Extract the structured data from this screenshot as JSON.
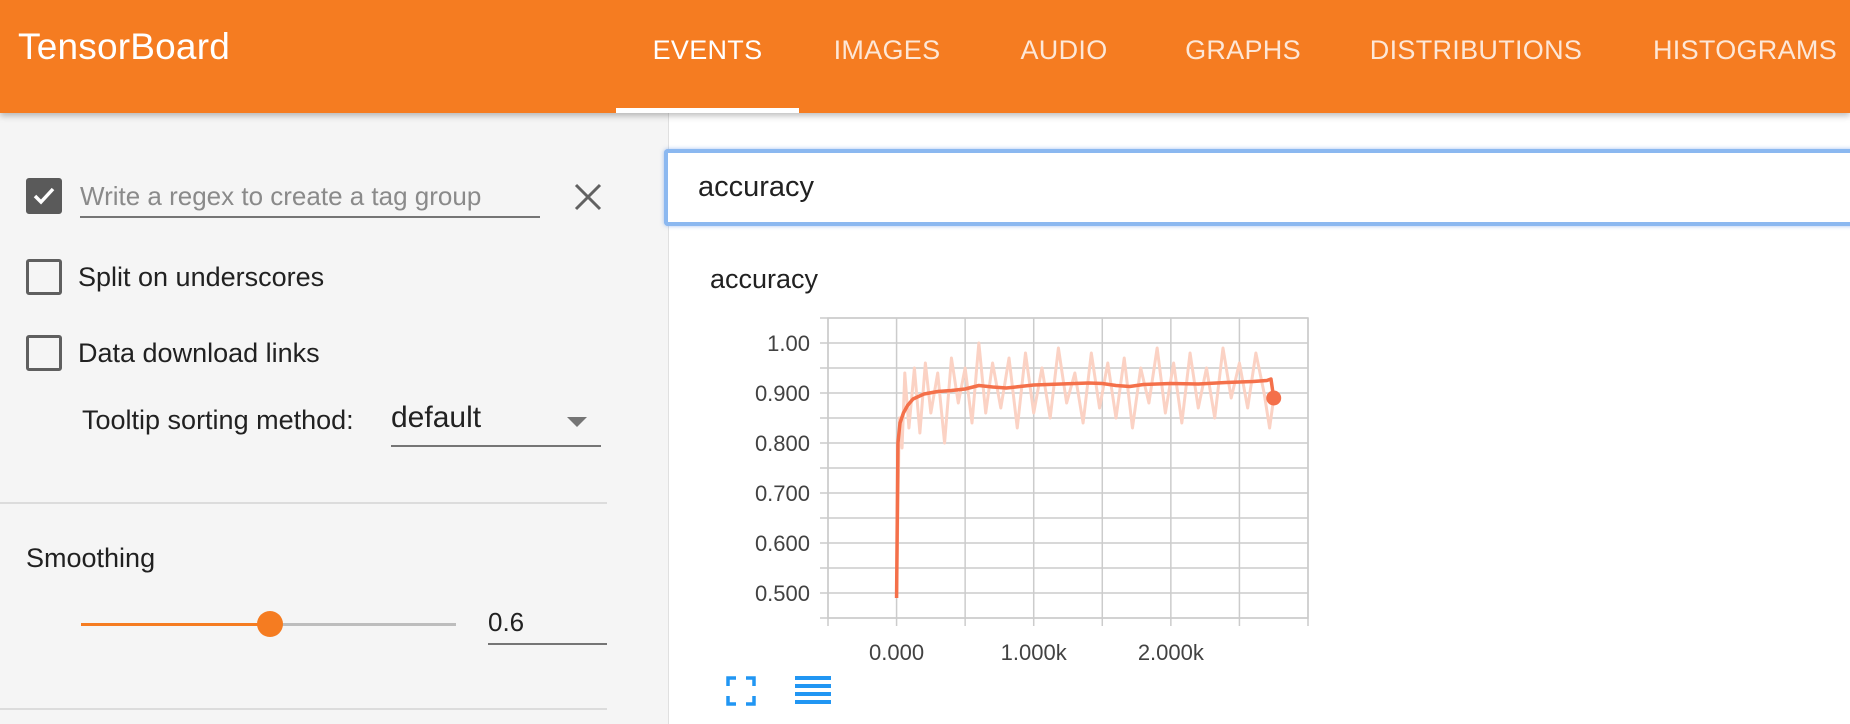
{
  "app": {
    "title": "TensorBoard"
  },
  "nav": {
    "tabs": [
      {
        "label": "EVENTS",
        "active": true
      },
      {
        "label": "IMAGES",
        "active": false
      },
      {
        "label": "AUDIO",
        "active": false
      },
      {
        "label": "GRAPHS",
        "active": false
      },
      {
        "label": "DISTRIBUTIONS",
        "active": false
      },
      {
        "label": "HISTOGRAMS",
        "active": false
      }
    ]
  },
  "sidebar": {
    "regex": {
      "checked": true,
      "placeholder": "Write a regex to create a tag group",
      "value": ""
    },
    "split_underscores": {
      "label": "Split on underscores",
      "checked": false
    },
    "download_links": {
      "label": "Data download links",
      "checked": false
    },
    "tooltip_sort": {
      "label": "Tooltip sorting method:",
      "value": "default"
    },
    "smoothing": {
      "title": "Smoothing",
      "value": "0.6",
      "fraction": 0.6
    }
  },
  "main": {
    "search": {
      "value": "accuracy"
    },
    "card": {
      "title": "accuracy"
    }
  },
  "colors": {
    "header": "#f57c21",
    "accent": "#f57c21",
    "line": "#f4704a",
    "raw": "#fbd2c4",
    "icon": "#2196f3"
  },
  "icons": {
    "close": "close-icon",
    "fullscreen": "fullscreen-icon",
    "data": "data-table-icon",
    "dropdown": "dropdown-arrow-icon",
    "check": "check-icon"
  },
  "chart_data": {
    "type": "line",
    "title": "accuracy",
    "x_ticks": [
      "0.000",
      "1.000k",
      "2.000k"
    ],
    "y_ticks": [
      "0.500",
      "0.600",
      "0.700",
      "0.800",
      "0.900",
      "1.00"
    ],
    "xlim": [
      -500,
      3000
    ],
    "ylim": [
      0.45,
      1.05
    ],
    "grid": true,
    "series": [
      {
        "style": "smoothed",
        "x": [
          0,
          10,
          25,
          50,
          80,
          120,
          200,
          300,
          400,
          500,
          600,
          700,
          800,
          900,
          1000,
          1200,
          1400,
          1500,
          1600,
          1700,
          1800,
          2000,
          2200,
          2400,
          2600,
          2700,
          2730,
          2750
        ],
        "y": [
          0.49,
          0.8,
          0.84,
          0.86,
          0.875,
          0.888,
          0.898,
          0.903,
          0.905,
          0.908,
          0.915,
          0.912,
          0.91,
          0.913,
          0.916,
          0.918,
          0.92,
          0.919,
          0.915,
          0.913,
          0.917,
          0.919,
          0.918,
          0.921,
          0.923,
          0.925,
          0.928,
          0.89
        ]
      },
      {
        "style": "raw",
        "x": [
          0,
          20,
          40,
          60,
          90,
          130,
          170,
          210,
          250,
          300,
          350,
          400,
          450,
          500,
          550,
          600,
          650,
          700,
          760,
          820,
          880,
          940,
          1000,
          1060,
          1120,
          1180,
          1240,
          1300,
          1360,
          1420,
          1480,
          1540,
          1600,
          1660,
          1720,
          1780,
          1840,
          1900,
          1960,
          2020,
          2080,
          2140,
          2200,
          2260,
          2320,
          2380,
          2440,
          2500,
          2560,
          2620,
          2680,
          2720,
          2750
        ],
        "y": [
          0.49,
          0.85,
          0.79,
          0.94,
          0.83,
          0.95,
          0.82,
          0.96,
          0.86,
          0.94,
          0.8,
          0.97,
          0.88,
          0.95,
          0.84,
          1.0,
          0.86,
          0.96,
          0.87,
          0.97,
          0.83,
          0.98,
          0.86,
          0.95,
          0.85,
          0.99,
          0.88,
          0.94,
          0.84,
          0.98,
          0.87,
          0.96,
          0.85,
          0.97,
          0.83,
          0.95,
          0.88,
          0.99,
          0.86,
          0.96,
          0.84,
          0.98,
          0.87,
          0.95,
          0.85,
          0.99,
          0.89,
          0.96,
          0.87,
          0.98,
          0.9,
          0.83,
          0.89
        ]
      }
    ]
  }
}
